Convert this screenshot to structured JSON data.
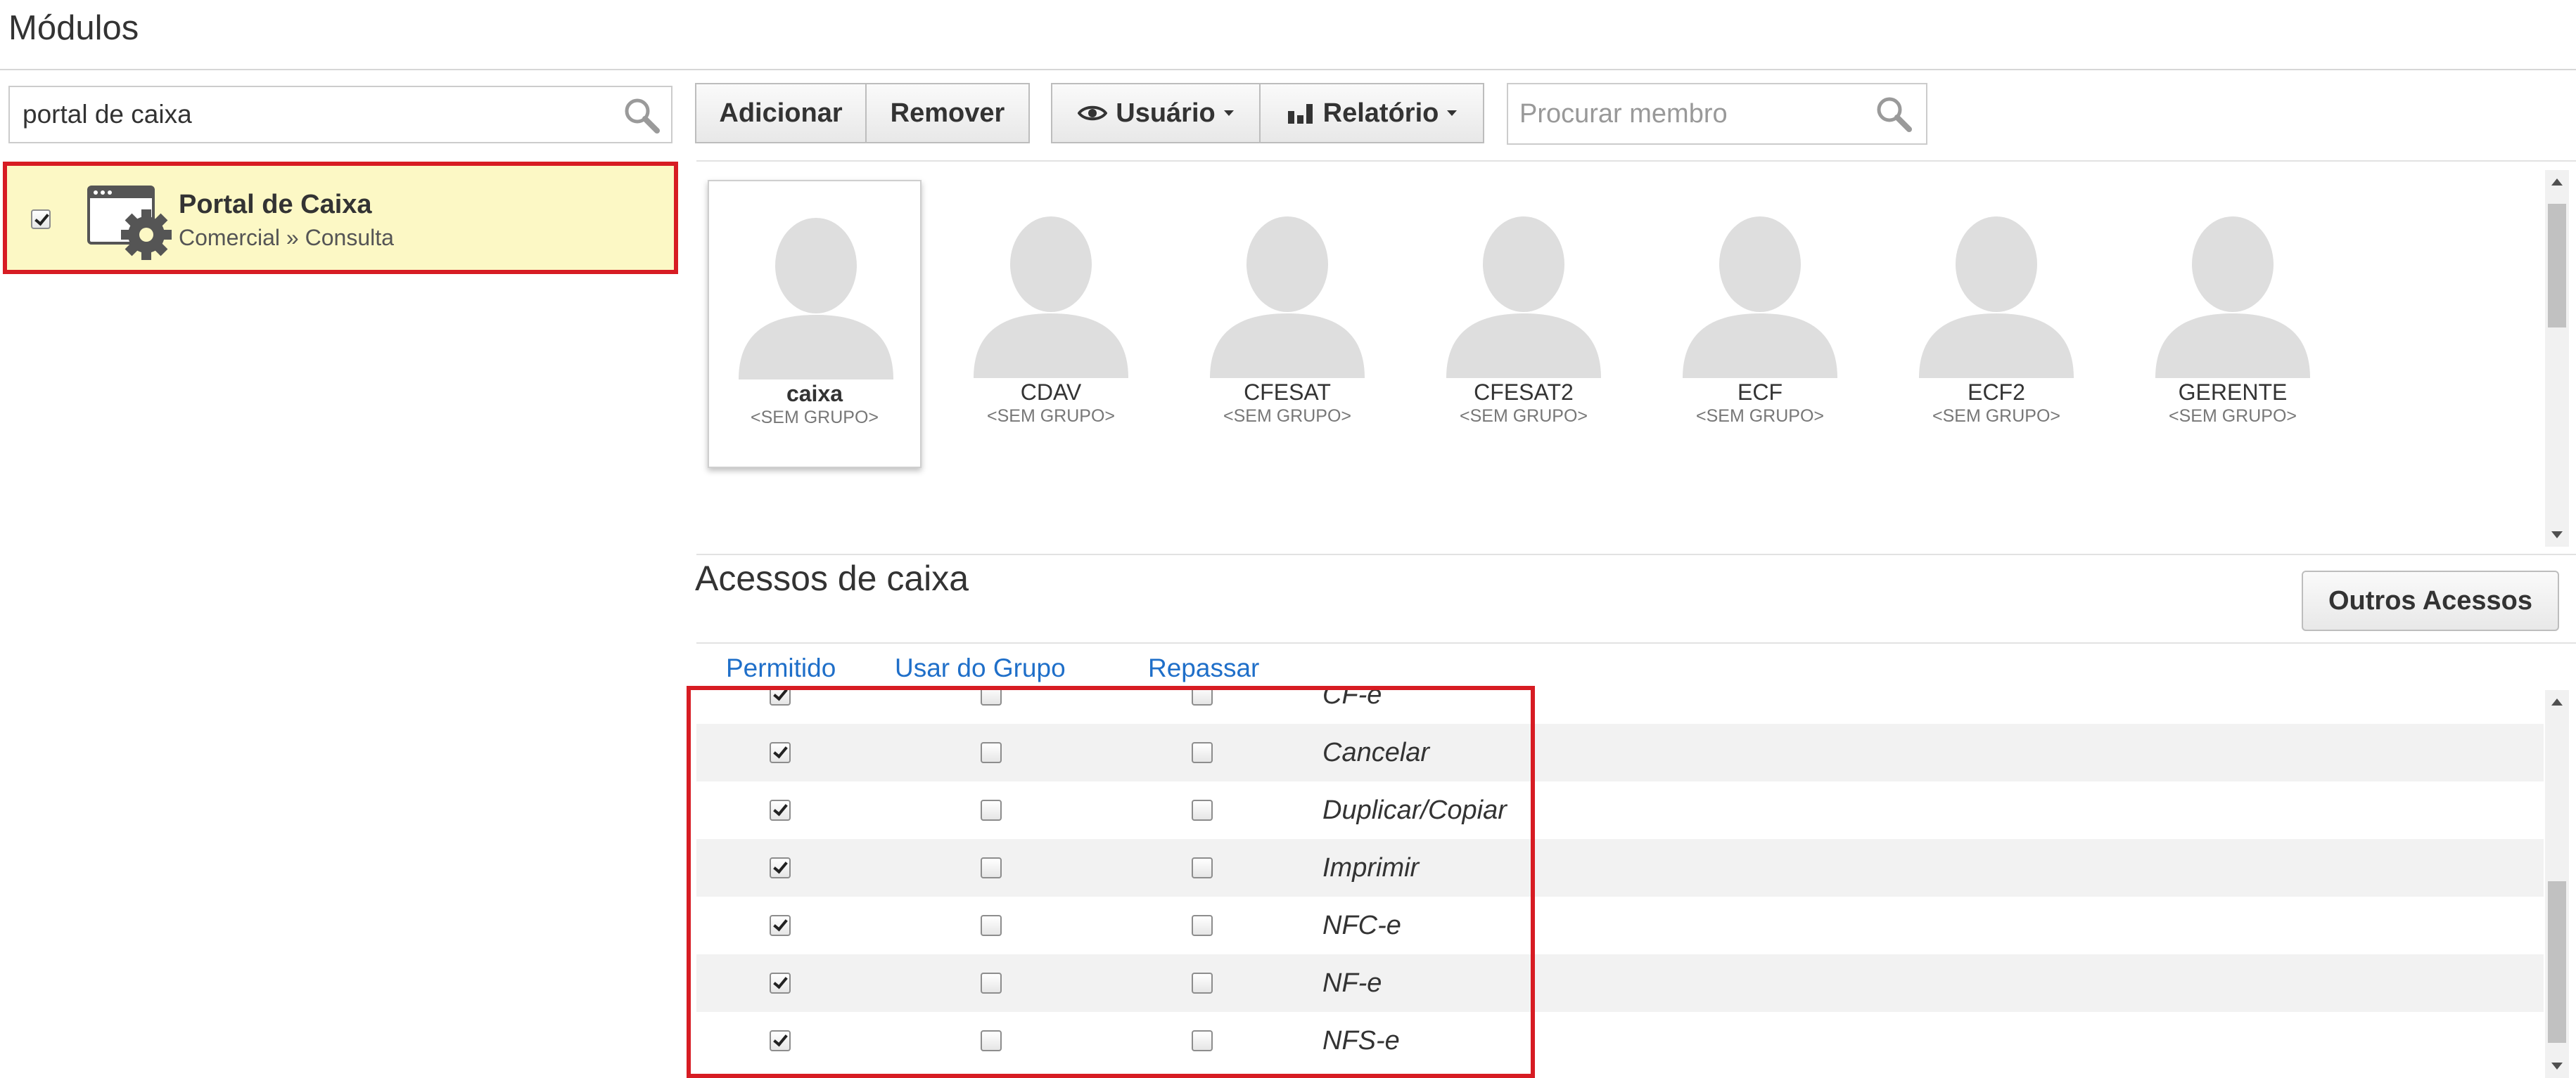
{
  "page": {
    "title": "Módulos"
  },
  "module_search": {
    "value": "portal de caixa"
  },
  "module": {
    "checked": true,
    "name": "Portal de Caixa",
    "path": "Comercial » Consulta"
  },
  "toolbar": {
    "add_label": "Adicionar",
    "remove_label": "Remover",
    "user_label": "Usuário",
    "report_label": "Relatório",
    "member_search_placeholder": "Procurar membro"
  },
  "members": [
    {
      "name": "caixa",
      "group": "<SEM GRUPO>",
      "selected": true
    },
    {
      "name": "CDAV",
      "group": "<SEM GRUPO>"
    },
    {
      "name": "CFESAT",
      "group": "<SEM GRUPO>"
    },
    {
      "name": "CFESAT2",
      "group": "<SEM GRUPO>"
    },
    {
      "name": "ECF",
      "group": "<SEM GRUPO>"
    },
    {
      "name": "ECF2",
      "group": "<SEM GRUPO>"
    },
    {
      "name": "GERENTE",
      "group": "<SEM GRUPO>"
    }
  ],
  "access": {
    "title": "Acessos de caixa",
    "other_button": "Outros Acessos",
    "columns": {
      "allowed": "Permitido",
      "use_group": "Usar do Grupo",
      "pass_on": "Repassar"
    },
    "rows": [
      {
        "label": "CF-e",
        "allowed": true,
        "use_group": false,
        "pass_on": false
      },
      {
        "label": "Cancelar",
        "allowed": true,
        "use_group": false,
        "pass_on": false
      },
      {
        "label": "Duplicar/Copiar",
        "allowed": true,
        "use_group": false,
        "pass_on": false
      },
      {
        "label": "Imprimir",
        "allowed": true,
        "use_group": false,
        "pass_on": false
      },
      {
        "label": "NFC-e",
        "allowed": true,
        "use_group": false,
        "pass_on": false
      },
      {
        "label": "NF-e",
        "allowed": true,
        "use_group": false,
        "pass_on": false
      },
      {
        "label": "NFS-e",
        "allowed": true,
        "use_group": false,
        "pass_on": false
      }
    ]
  },
  "colors": {
    "highlight_border": "#d71c23",
    "selected_row_bg": "#fcf8c5",
    "link_blue": "#1f6fc9"
  }
}
